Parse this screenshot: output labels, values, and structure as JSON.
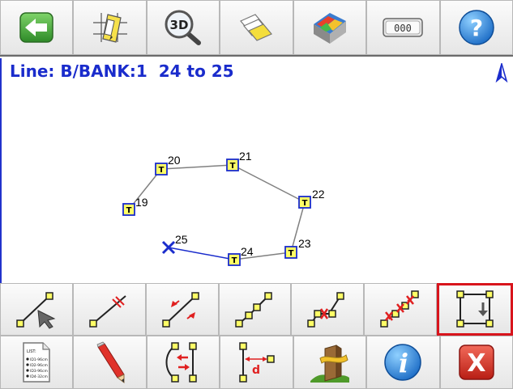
{
  "top_toolbar": [
    {
      "name": "back-button",
      "icon": "back-arrow-icon"
    },
    {
      "name": "edit-plan-button",
      "icon": "plan-edit-icon"
    },
    {
      "name": "3d-view-button",
      "icon": "3d-magnifier-icon",
      "text": "3D"
    },
    {
      "name": "layers-button",
      "icon": "layers-icon"
    },
    {
      "name": "surface-model-button",
      "icon": "surface-model-icon"
    },
    {
      "name": "keypad-button",
      "icon": "keypad-icon",
      "text": "000"
    },
    {
      "name": "help-button",
      "icon": "help-icon",
      "text": "?"
    }
  ],
  "canvas": {
    "title": "Line: B/BANK:1  24 to 25",
    "north_icon": "north-arrow-icon",
    "points": [
      {
        "label": "19",
        "code": "T"
      },
      {
        "label": "20",
        "code": "T"
      },
      {
        "label": "21",
        "code": "T"
      },
      {
        "label": "22",
        "code": "T"
      },
      {
        "label": "23",
        "code": "T"
      },
      {
        "label": "24",
        "code": "T"
      },
      {
        "label": "25",
        "code": ""
      }
    ],
    "line_color": "#808080",
    "active_color": "#1a2ccc"
  },
  "line_tools": [
    {
      "name": "select-line-button",
      "icon": "select-line-icon"
    },
    {
      "name": "break-line-button",
      "icon": "break-line-icon"
    },
    {
      "name": "reverse-line-button",
      "icon": "reverse-line-icon"
    },
    {
      "name": "polyline-button",
      "icon": "polyline-icon"
    },
    {
      "name": "delete-point-button",
      "icon": "delete-point-icon"
    },
    {
      "name": "delete-segments-button",
      "icon": "delete-segments-icon"
    },
    {
      "name": "close-line-button",
      "icon": "close-line-icon",
      "selected": true
    }
  ],
  "bottom_tools": [
    {
      "name": "list-button",
      "icon": "list-icon",
      "text": "LIST:",
      "lines": [
        "ID1-96cm",
        "ID2-96cm",
        "ID3-96cm",
        "ID4-32cm"
      ]
    },
    {
      "name": "edit-button",
      "icon": "pencil-icon"
    },
    {
      "name": "curve-direction-button",
      "icon": "curve-direction-icon"
    },
    {
      "name": "offset-button",
      "icon": "offset-icon",
      "text": "d"
    },
    {
      "name": "stake-button",
      "icon": "stake-icon"
    },
    {
      "name": "info-button",
      "icon": "info-icon",
      "text": "i"
    },
    {
      "name": "close-button",
      "icon": "close-icon",
      "text": "X"
    }
  ],
  "colors": {
    "selected_border": "#d8141c",
    "title": "#1a2ccc"
  }
}
